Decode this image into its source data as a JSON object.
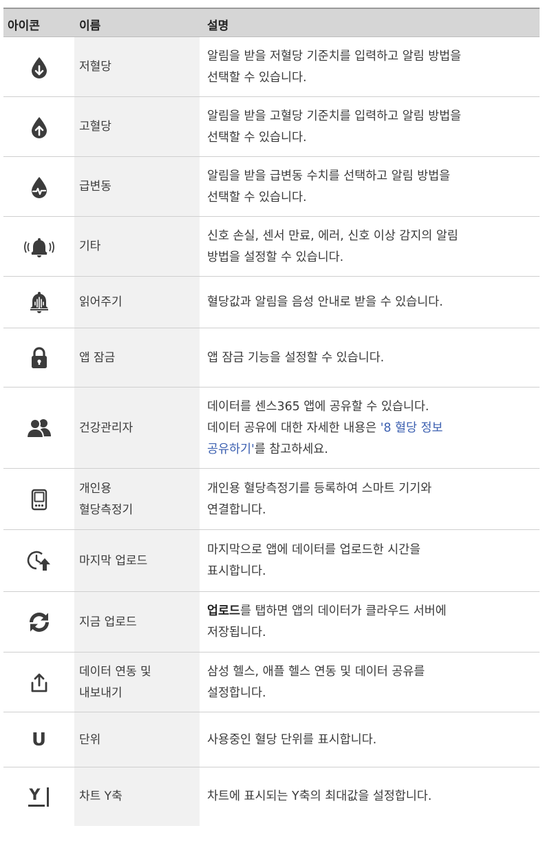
{
  "header": {
    "icon": "아이콘",
    "name": "이름",
    "desc": "설명"
  },
  "rows": [
    {
      "icon": "drop-down-arrow-icon",
      "name": "저혈당",
      "lines": [
        [
          {
            "t": "알림을 받을 저혈당 기준치를 입력하고 알림 방법을"
          }
        ],
        [
          {
            "t": "선택할 수 있습니다."
          }
        ]
      ]
    },
    {
      "icon": "drop-up-arrow-icon",
      "name": "고혈당",
      "lines": [
        [
          {
            "t": "알림을 받을 고혈당 기준치를 입력하고 알림 방법을"
          }
        ],
        [
          {
            "t": "선택할 수 있습니다."
          }
        ]
      ]
    },
    {
      "icon": "drop-pulse-icon",
      "name": "급변동",
      "lines": [
        [
          {
            "t": "알림을 받을 급변동 수치를 선택하고 알림 방법을"
          }
        ],
        [
          {
            "t": "선택할 수 있습니다."
          }
        ]
      ]
    },
    {
      "icon": "ringing-bell-icon",
      "name": "기타",
      "lines": [
        [
          {
            "t": "신호 손실, 센서 만료, 에러, 신호 이상 감지의 알림"
          }
        ],
        [
          {
            "t": "방법을 설정할 수 있습니다."
          }
        ]
      ]
    },
    {
      "icon": "bell-read-aloud-icon",
      "name": "읽어주기",
      "lines": [
        [
          {
            "t": "혈당값과 알림을 음성 안내로 받을 수 있습니다."
          }
        ]
      ]
    },
    {
      "icon": "lock-icon",
      "name": "앱 잠금",
      "lines": [
        [
          {
            "t": "앱 잠금 기능을 설정할 수 있습니다."
          }
        ]
      ]
    },
    {
      "icon": "users-icon",
      "name": "건강관리자",
      "lines": [
        [
          {
            "t": "데이터를 센스365 앱에 공유할 수 있습니다."
          }
        ],
        [
          {
            "t": "데이터 공유에 대한 자세한 내용은 "
          },
          {
            "t": "'8 혈당 정보",
            "style": "link"
          }
        ],
        [
          {
            "t": "공유하기'",
            "style": "link"
          },
          {
            "t": "를 참고하세요."
          }
        ]
      ]
    },
    {
      "icon": "meter-device-icon",
      "name": "개인용\n혈당측정기",
      "lines": [
        [
          {
            "t": "개인용 혈당측정기를 등록하여 스마트 기기와"
          }
        ],
        [
          {
            "t": "연결합니다."
          }
        ]
      ]
    },
    {
      "icon": "clock-upload-icon",
      "name": "마지막 업로드",
      "lines": [
        [
          {
            "t": "마지막으로 앱에 데이터를 업로드한 시간을"
          }
        ],
        [
          {
            "t": "표시합니다."
          }
        ]
      ]
    },
    {
      "icon": "sync-icon",
      "name": "지금 업로드",
      "lines": [
        [
          {
            "t": "업로드",
            "style": "bold"
          },
          {
            "t": "를 탭하면 앱의 데이터가 클라우드 서버에"
          }
        ],
        [
          {
            "t": "저장됩니다."
          }
        ]
      ]
    },
    {
      "icon": "share-export-icon",
      "name": "데이터 연동 및\n내보내기",
      "lines": [
        [
          {
            "t": "삼성 헬스, 애플 헬스 연동 및 데이터 공유를"
          }
        ],
        [
          {
            "t": "설정합니다."
          }
        ]
      ]
    },
    {
      "icon": "unit-u-icon",
      "glyph": "U",
      "name": "단위",
      "lines": [
        [
          {
            "t": "사용중인 혈당 단위를 표시합니다."
          }
        ]
      ]
    },
    {
      "icon": "chart-y-axis-icon",
      "glyph": "Y",
      "name": "차트 Y축",
      "lines": [
        [
          {
            "t": "차트에 표시되는 Y축의 최대값을 설정합니다."
          }
        ]
      ]
    }
  ]
}
